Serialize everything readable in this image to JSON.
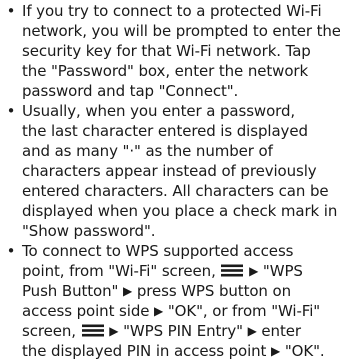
{
  "items": [
    {
      "bullet": "•",
      "lines": [
        "If you try to connect to a protected Wi-Fi",
        "network, you will be prompted to enter the",
        "security key for that Wi-Fi network. Tap",
        "the \"Password\" box, enter the network",
        "password and tap \"Connect\"."
      ]
    },
    {
      "bullet": "•",
      "lines": [
        "Usually, when you enter a password,",
        "the last character entered is displayed",
        "and as many \"·\" as the number of",
        "characters appear instead of previously",
        "entered characters. All characters can be",
        "displayed when you place a check mark in",
        "\"Show password\"."
      ]
    },
    {
      "bullet": "•",
      "lines": [
        "To connect to WPS supported access",
        "point, from \"Wi-Fi\" screen,",
        "Push Button\"",
        "press WPS button on",
        "access point side",
        "\"OK\", or from \"Wi-Fi\"",
        "screen,",
        "\"WPS PIN Entry\"",
        "enter",
        "the displayed PIN in access point",
        "\"OK\"."
      ],
      "wps_push_text": "\"WPS",
      "arrow_glyph": "▶",
      "menu_icon": "menu-bars-icon"
    }
  ]
}
